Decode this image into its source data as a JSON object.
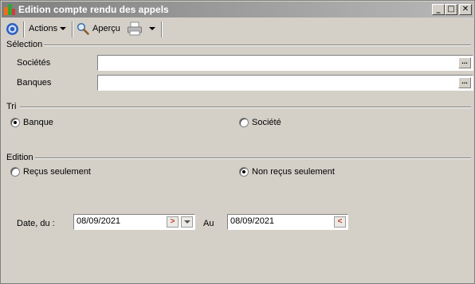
{
  "window": {
    "title": "Edition compte rendu des appels",
    "controls": {
      "minimize": "_",
      "maximize": "□",
      "close": "✕"
    }
  },
  "toolbar": {
    "actions_label": "Actions",
    "apercu_label": "Aperçu",
    "icons": [
      "circle-nav-icon",
      "magnifier-icon",
      "printer-icon"
    ]
  },
  "selection": {
    "title": "Sélection",
    "societes": {
      "label": "Sociétés",
      "value": ""
    },
    "banques": {
      "label": "Banques",
      "value": ""
    },
    "picker_label": "..."
  },
  "tri": {
    "title": "Tri",
    "options": [
      {
        "label": "Banque",
        "checked": true
      },
      {
        "label": "Société",
        "checked": false
      }
    ]
  },
  "edition": {
    "title": "Edition",
    "options": [
      {
        "label": "Reçus seulement",
        "checked": false
      },
      {
        "label": "Non reçus seulement",
        "checked": true
      }
    ]
  },
  "dates": {
    "from_label": "Date, du :",
    "from_value": "08/09/2021",
    "to_label": "Au",
    "to_value": "08/09/2021"
  },
  "colors": {
    "window_bg": "#d4d0c8",
    "title_text": "#ffffff",
    "accent_blue": "#2f5fbf",
    "date_arrow_red": "#c0392b"
  }
}
